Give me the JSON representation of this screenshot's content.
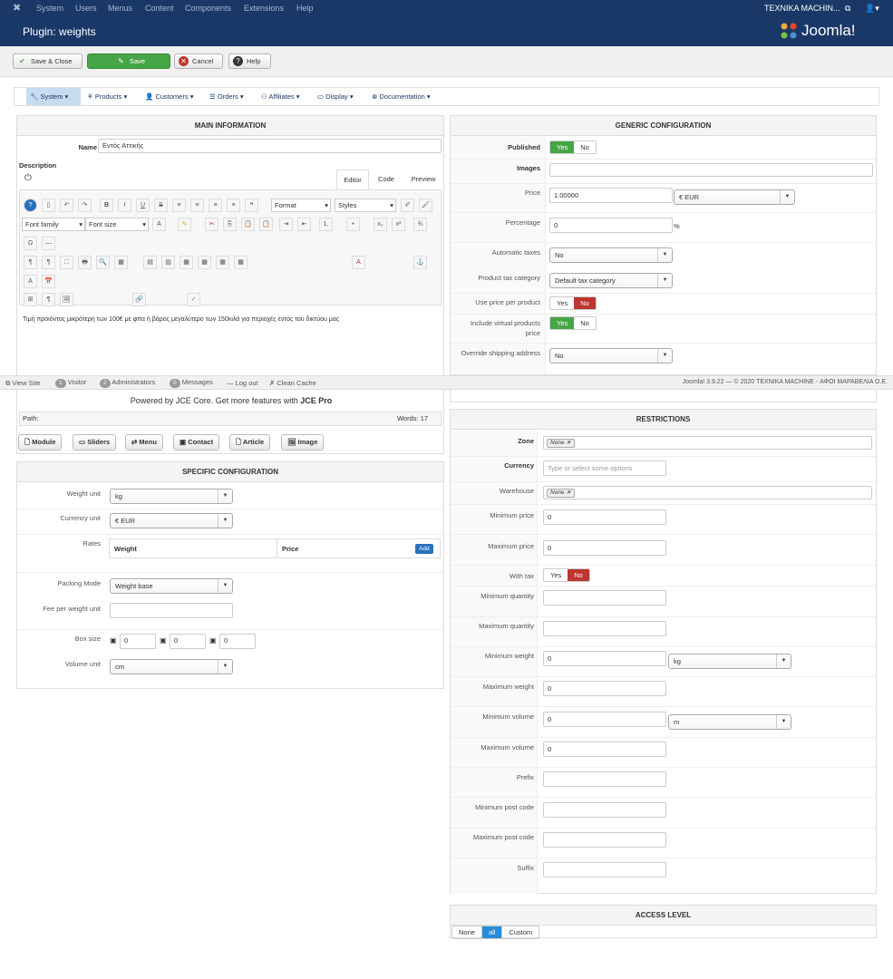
{
  "topbar": {
    "logo_icon": "joomla-icon",
    "menu": [
      "System",
      "Users",
      "Menus",
      "Content",
      "Components",
      "Extensions",
      "Help"
    ],
    "site": "ΤΕΧΝΙΚΑ MACHIN...",
    "user_icon": "user-icon"
  },
  "title": {
    "text": "Plugin: weights",
    "brand": "Joomla!"
  },
  "toolbar": {
    "save_close": "Save & Close",
    "save": "Save",
    "cancel": "Cancel",
    "help": "Help"
  },
  "hikamenu": [
    "System",
    "Products",
    "Customers",
    "Orders",
    "Affiliates",
    "Display",
    "Documentation"
  ],
  "main": {
    "header": "MAIN INFORMATION",
    "name_label": "Name",
    "name_value": "Εντός Αττικής",
    "desc_label": "Description",
    "tabs": [
      "Editor",
      "Code",
      "Preview"
    ],
    "font_family": "Font family",
    "font_size": "Font size",
    "format": "Format",
    "styles": "Styles",
    "content": "Τιμή προιόντος μικρότερη των 100€ με φπα ή βάρος μεγαλύτερο των 150κιλά για περιοχές εντός του δικτύου μας",
    "powered": "Powered by JCE Core. Get more features with ",
    "powered_pro": "JCE Pro",
    "path": "Path:",
    "words": "Words: 17",
    "buttons": [
      "Module",
      "Sliders",
      "Menu",
      "Contact",
      "Article",
      "Image"
    ]
  },
  "status": {
    "view_site": "View Site",
    "visitor_count": "1",
    "visitor": "Visitor",
    "admin_count": "2",
    "admins": "Administrators",
    "msg_count": "0",
    "messages": "Messages",
    "logout": "Log out",
    "clean": "Clean Cache",
    "footer": "Joomla! 3.9.22 — © 2020 ΤΕΧΝΙΚΑ MACHINE - ΑΦΟΙ ΜΑΡΑΒΕΛΙΑ Ο.Ε."
  },
  "specific": {
    "header": "SPECIFIC CONFIGURATION",
    "weight_unit_label": "Weight unit",
    "weight_unit": "kg",
    "currency_unit_label": "Currency unit",
    "currency_unit": "€ EUR",
    "rates_label": "Rates",
    "col_weight": "Weight",
    "col_price": "Price",
    "add": "Add",
    "packing_label": "Packing Mode",
    "packing": "Weight base",
    "fee_label": "Fee per weight unit",
    "fee": "",
    "box_label": "Box size",
    "box": [
      "0",
      "0",
      "0"
    ],
    "volume_label": "Volume unit",
    "volume": "cm"
  },
  "generic": {
    "header": "GENERIC CONFIGURATION",
    "published": "Published",
    "yes": "Yes",
    "no": "No",
    "images": "Images",
    "price_label": "Price",
    "price": "1.00000",
    "price_currency": "€ EUR",
    "percentage_label": "Percentage",
    "percentage": "0",
    "pct": "%",
    "auto_taxes_label": "Automatic taxes",
    "auto_taxes": "No",
    "tax_cat_label": "Product tax category",
    "tax_cat": "Default tax category",
    "use_price_label": "Use price per product",
    "virtual_label": "Include virtual products price",
    "override_label": "Override shipping address",
    "override": "No"
  },
  "restrictions": {
    "header": "RESTRICTIONS",
    "zone": "Zone",
    "zone_tag": "None",
    "currency": "Currency",
    "currency_ph": "Type or select some options",
    "warehouse": "Warehouse",
    "warehouse_tag": "None",
    "min_price": "Minimum price",
    "min_price_v": "0",
    "max_price": "Maximum price",
    "max_price_v": "0",
    "with_tax": "With tax",
    "min_qty": "Minimum quantity",
    "max_qty": "Maximum quantity",
    "min_weight": "Minimum weight",
    "min_weight_v": "0",
    "min_weight_unit": "kg",
    "max_weight": "Maximum weight",
    "max_weight_v": "0",
    "min_volume": "Minimum volume",
    "min_volume_v": "0",
    "min_volume_unit": "m",
    "max_volume": "Maximum volume",
    "max_volume_v": "0",
    "prefix": "Prefix",
    "min_post": "Minimum post code",
    "max_post": "Maximum post code",
    "suffix": "Suffix"
  },
  "access": {
    "header": "ACCESS LEVEL",
    "options": [
      "None",
      "all",
      "Custom"
    ]
  }
}
